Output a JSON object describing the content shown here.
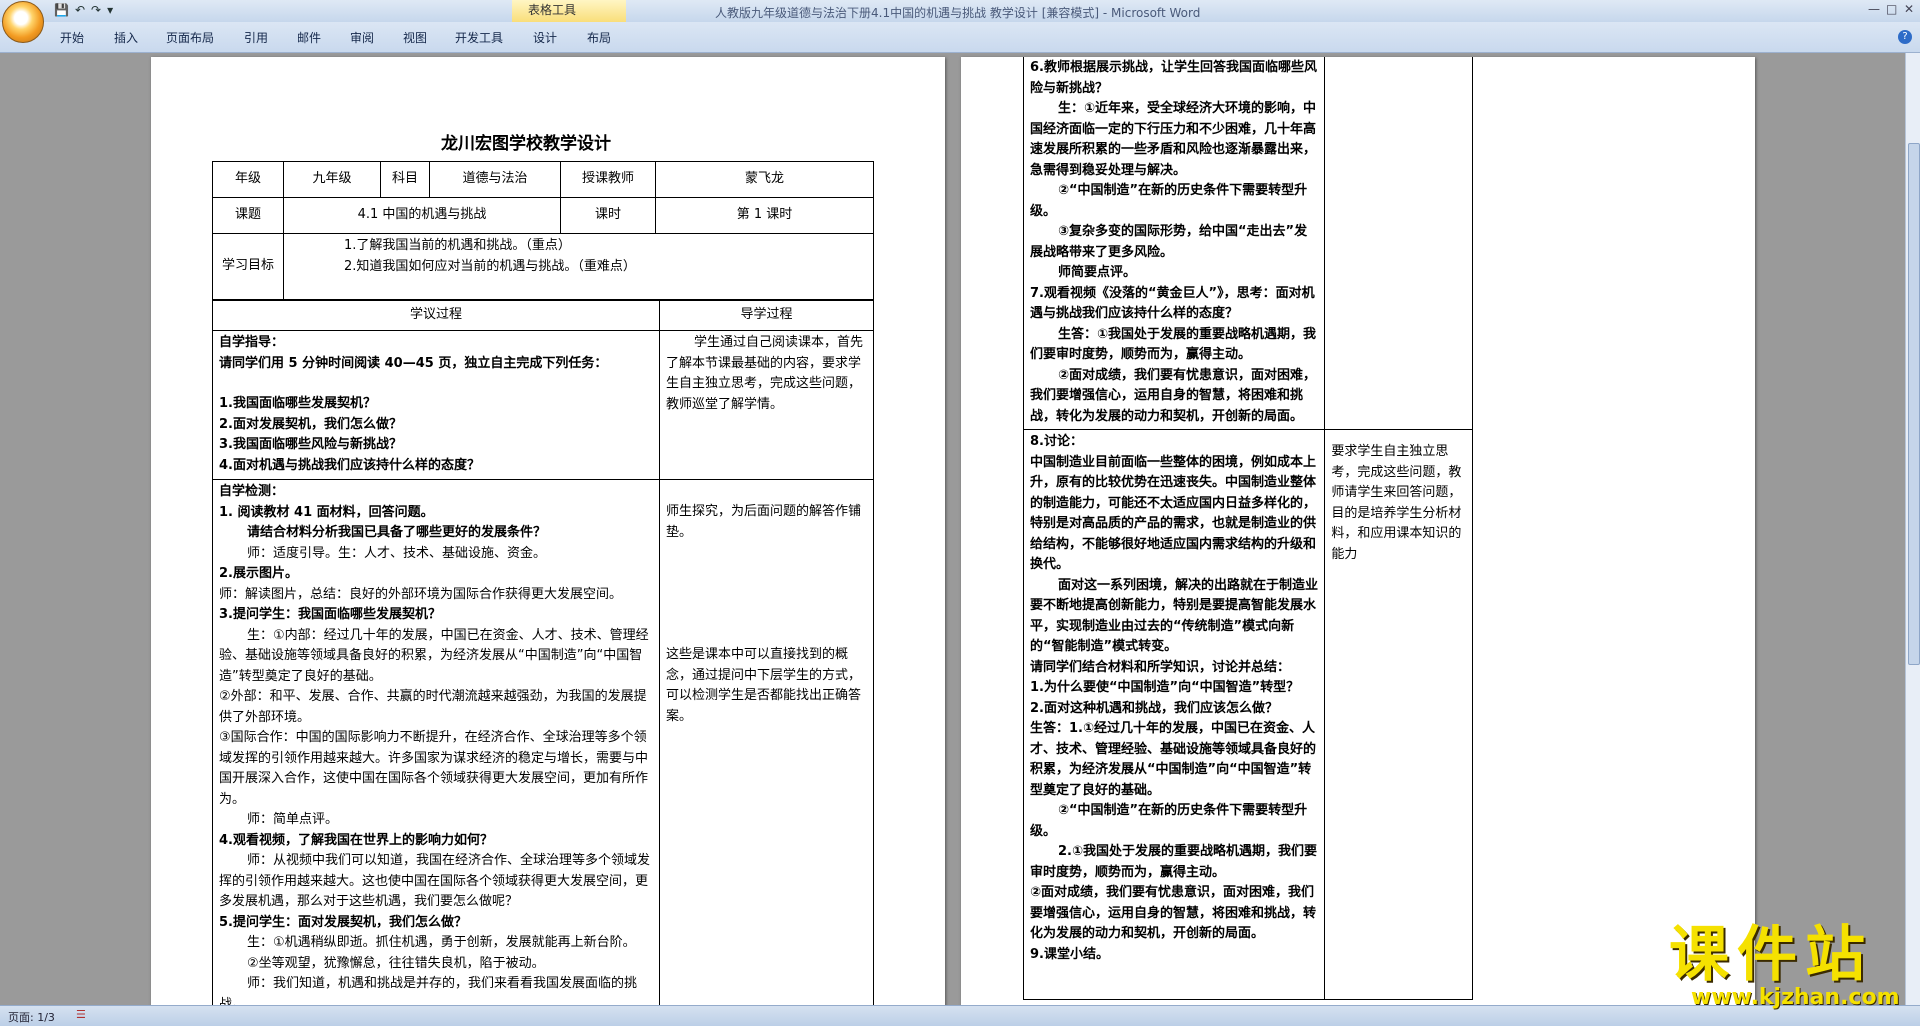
{
  "window": {
    "title": "人教版九年级道德与法治下册4.1中国的机遇与挑战    教学设计 [兼容模式] - Microsoft Word",
    "context_tab_header": "表格工具",
    "qat_icons": [
      "save-icon",
      "undo-icon",
      "redo-icon",
      "customize-icon"
    ]
  },
  "ribbon": {
    "tabs": [
      "开始",
      "插入",
      "页面布局",
      "引用",
      "邮件",
      "审阅",
      "视图",
      "开发工具",
      "设计",
      "布局"
    ]
  },
  "status": {
    "page": "页面: 1/3"
  },
  "doc": {
    "title": "龙川宏图学校教学设计",
    "header": {
      "grade_label": "年级",
      "grade": "九年级",
      "subject_label": "科目",
      "subject": "道德与法治",
      "teacher_label": "授课教师",
      "teacher": "蒙飞龙",
      "topic_label": "课题",
      "topic": "4.1 中国的机遇与挑战",
      "period_label": "课时",
      "period": "第 1 课时",
      "goals_label": "学习目标",
      "goal1": "1.了解我国当前的机遇和挑战。（重点）",
      "goal2": "2.知道我国如何应对当前的机遇与挑战。（重难点）"
    },
    "col1_header": "学议过程",
    "col2_header": "导学过程",
    "block1": [
      "自学指导：",
      "请同学们用 5 分钟时间阅读 40—45 页，独立自主完成下列任务：",
      "",
      "1.我国面临哪些发展契机？",
      "2.面对发展契机，我们怎么做？",
      "3.我国面临哪些风险与新挑战？",
      "4.面对机遇与挑战我们应该持什么样的态度？"
    ],
    "block1_note": "学生通过自己阅读课本，首先了解本节课最基础的内容，要求学生自主独立思考，完成这些问题，教师巡堂了解学情。",
    "block2": [
      "自学检测：",
      "1. 阅读教材 41 面材料，回答问题。",
      "请结合材料分析我国已具备了哪些更好的发展条件？",
      "师：适度引导。生：人才、技术、基础设施、资金。",
      "2.展示图片。",
      "师：解读图片，总结：良好的外部环境为国际合作获得更大发展空间。",
      "3.提问学生：我国面临哪些发展契机？",
      "生：①内部：经过几十年的发展，中国已在资金、人才、技术、管理经验、基础设施等领域具备良好的积累，为经济发展从“中国制造”向“中国智造”转型奠定了良好的基础。",
      "②外部：和平、发展、合作、共赢的时代潮流越来越强劲，为我国的发展提供了外部环境。",
      "③国际合作：中国的国际影响力不断提升，在经济合作、全球治理等多个领域发挥的引领作用越来越大。许多国家为谋求经济的稳定与增长，需要与中国开展深入合作，这使中国在国际各个领域获得更大发展空间，更加有所作为。",
      "师：简单点评。",
      "4.观看视频，了解我国在世界上的影响力如何？",
      "师：从视频中我们可以知道，我国在经济合作、全球治理等多个领域发挥的引领作用越来越大。这也使中国在国际各个领域获得更大发展空间，更多发展机遇，那么对于这些机遇，我们要怎么做呢？",
      "5.提问学生：面对发展契机，我们怎么做？",
      "生：①机遇稍纵即逝。抓住机遇，勇于创新，发展就能再上新台阶。",
      "②坐等观望，犹豫懈怠，往往错失良机，陷于被动。",
      "师：我们知道，机遇和挑战是并存的，我们来看看我国发展面临的挑战。"
    ],
    "block2_note1": "师生探究，为后面问题的解答作铺垫。",
    "block2_note2": "这些是课本中可以直接找到的概念，通过提问中下层学生的方式，可以检测学生是否都能找出正确答案。",
    "page2_block1": [
      "6.教师根据展示挑战，让学生回答我国面临哪些风险与新挑战？",
      "生：①近年来，受全球经济大环境的影响，中国经济面临一定的下行压力和不少困难，几十年高速发展所积累的一些矛盾和风险也逐渐暴露出来，急需得到稳妥处理与解决。",
      "②“中国制造”在新的历史条件下需要转型升级。",
      "③复杂多变的国际形势，给中国“走出去”发展战略带来了更多风险。",
      "师简要点评。",
      "7.观看视频《没落的“黄金巨人”》，思考：面对机遇与挑战我们应该持什么样的态度？",
      "生答：①我国处于发展的重要战略机遇期，我们要审时度势，顺势而为，赢得主动。",
      "②面对成绩，我们要有忧患意识，面对困难，我们要增强信心，运用自身的智慧，将困难和挑战，转化为发展的动力和契机，开创新的局面。"
    ],
    "page2_block2": [
      "8.讨论：",
      "中国制造业目前面临一些整体的困境，例如成本上升，原有的比较优势在迅速丧失。中国制造业整体的制造能力，可能还不太适应国内日益多样化的，特别是对高品质的产品的需求，也就是制造业的供给结构，不能够很好地适应国内需求结构的升级和换代。",
      "面对这一系列困境，解决的出路就在于制造业要不断地提高创新能力，特别是要提高智能发展水平，实现制造业由过去的“传统制造”模式向新的“智能制造”模式转变。",
      "请同学们结合材料和所学知识，讨论并总结：",
      "1.为什么要使“中国制造”向“中国智造”转型？",
      "2.面对这种机遇和挑战，我们应该怎么做？",
      "生答：1.①经过几十年的发展，中国已在资金、人才、技术、管理经验、基础设施等领域具备良好的积累，为经济发展从“中国制造”向“中国智造”转型奠定了良好的基础。",
      "②“中国制造”在新的历史条件下需要转型升级。",
      "2.①我国处于发展的重要战略机遇期，我们要审时度势，顺势而为，赢得主动。",
      "②面对成绩，我们要有忧患意识，面对困难，我们要增强信心，运用自身的智慧，将困难和挑战，转化为发展的动力和契机，开创新的局面。",
      "9.课堂小结。"
    ],
    "page2_note": "要求学生自主独立思考，完成这些问题，教师请学生来回答问题，目的是培养学生分析材料，和应用课本知识的能力"
  },
  "watermark": {
    "main": "课件站",
    "url": "www.kjzhan.com"
  }
}
